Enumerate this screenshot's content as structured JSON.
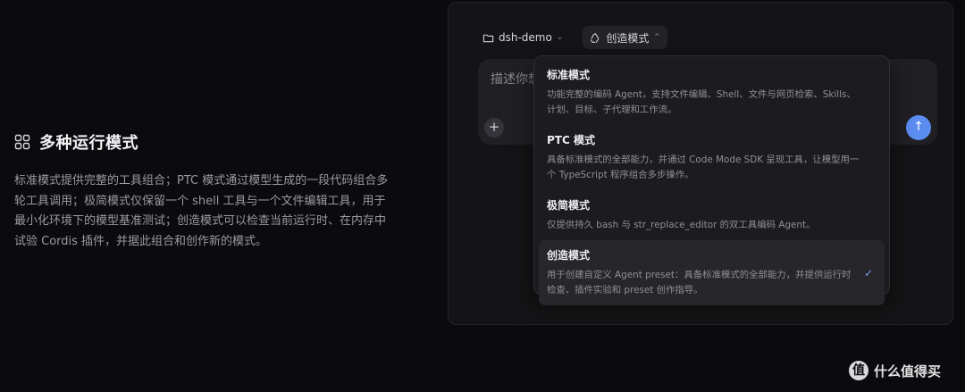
{
  "feature": {
    "icon": "grid-icon",
    "title": "多种运行模式",
    "description": "标准模式提供完整的工具组合；PTC 模式通过模型生成的一段代码组合多轮工具调用；极简模式仅保留一个 shell 工具与一个文件编辑工具，用于最小化环境下的模型基准测试；创造模式可以检查当前运行时、在内存中试验 Cordis 插件，并据此组合和创作新的模式。"
  },
  "toolbar": {
    "folder": {
      "icon": "folder-icon",
      "label": "dsh-demo"
    },
    "mode": {
      "icon": "recycle-icon",
      "label": "创造模式"
    }
  },
  "composer": {
    "placeholder": "描述你想",
    "plus_label": "+",
    "send_icon": "arrow-up-icon",
    "send_glyph": "↑"
  },
  "menu": {
    "items": [
      {
        "title": "标准模式",
        "desc": "功能完整的编码 Agent，支持文件编辑、Shell、文件与网页检索、Skills、计划、目标、子代理和工作流。",
        "selected": false
      },
      {
        "title": "PTC 模式",
        "desc": "具备标准模式的全部能力，并通过 Code Mode SDK 呈现工具，让模型用一个 TypeScript 程序组合多步操作。",
        "selected": false
      },
      {
        "title": "极简模式",
        "desc": "仅提供持久 bash 与 str_replace_editor 的双工具编码 Agent。",
        "selected": false
      },
      {
        "title": "创造模式",
        "desc": "用于创建自定义 Agent preset：具备标准模式的全部能力，并提供运行时检查、插件实验和 preset 创作指导。",
        "selected": true
      }
    ],
    "check_glyph": "✓"
  },
  "watermark": {
    "logo": "值",
    "text": "什么值得买"
  },
  "colors": {
    "accent": "#5b8cf0",
    "background": "#0b0b0d",
    "menu_bg": "#1c1c20"
  }
}
